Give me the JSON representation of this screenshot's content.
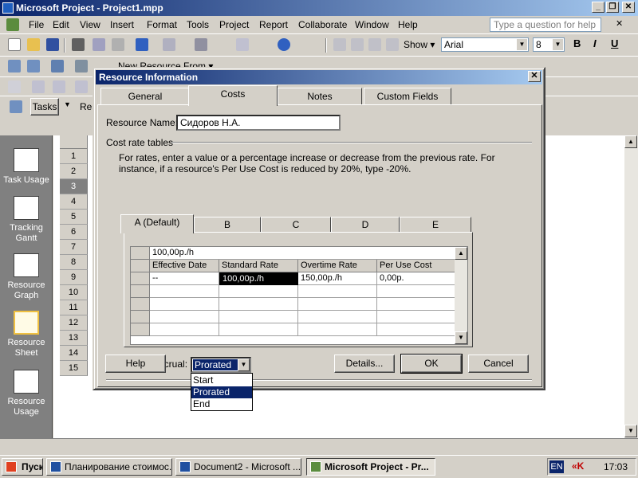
{
  "window": {
    "title": "Microsoft Project - Project1.mpp",
    "minimize": "_",
    "restore": "❐",
    "close": "✕"
  },
  "menu": {
    "items": [
      "File",
      "Edit",
      "View",
      "Insert",
      "Format",
      "Tools",
      "Project",
      "Report",
      "Collaborate",
      "Window",
      "Help"
    ],
    "help_placeholder": "Type a question for help",
    "doc_close": "✕"
  },
  "toolbar": {
    "show_label": "Show ▾",
    "font_name": "Arial",
    "font_size": "8",
    "bold": "B",
    "italic": "I",
    "underline": "U",
    "new_resource_from": "New Resource From ▾",
    "tasks": "Tasks",
    "resources": "Res"
  },
  "viewbar": {
    "items": [
      "Task Usage",
      "Tracking Gantt",
      "Resource Graph",
      "Resource Sheet",
      "Resource Usage"
    ],
    "selected": "Resource Sheet"
  },
  "rows": [
    "1",
    "2",
    "3",
    "4",
    "5",
    "6",
    "7",
    "8",
    "9",
    "10",
    "11",
    "12",
    "13",
    "14",
    "15"
  ],
  "dialog": {
    "title": "Resource Information",
    "close": "✕",
    "tabs": [
      "General",
      "Costs",
      "Notes",
      "Custom Fields"
    ],
    "active_tab": "Costs",
    "resource_name_label": "Resource Name:",
    "resource_name": "Сидоров Н.А.",
    "cost_rate_tables_label": "Cost rate tables",
    "instructions": "For rates, enter a value or a percentage increase or decrease from the previous rate. For instance, if a resource's Per Use Cost is reduced by 20%, type -20%.",
    "rate_tabs": [
      "A (Default)",
      "B",
      "C",
      "D",
      "E"
    ],
    "active_rate_tab": "A (Default)",
    "edit_value": "100,00р./h",
    "columns": [
      "Effective Date",
      "Standard Rate",
      "Overtime Rate",
      "Per Use Cost"
    ],
    "rate_rows": [
      {
        "effective_date": "--",
        "standard_rate": "100,00р./h",
        "overtime_rate": "150,00р./h",
        "per_use_cost": "0,00р."
      }
    ],
    "cost_accrual_label": "Cost accrual:",
    "cost_accrual_value": "Prorated",
    "cost_accrual_options": [
      "Start",
      "Prorated",
      "End"
    ],
    "buttons": {
      "help": "Help",
      "details": "Details...",
      "ok": "OK",
      "cancel": "Cancel"
    }
  },
  "taskbar": {
    "start": "Пуск",
    "tasks": [
      "Планирование стоимос...",
      "Document2 - Microsoft ...",
      "Microsoft Project - Pr..."
    ],
    "active_task": "Microsoft Project - Pr...",
    "lang": "EN",
    "clock": "17:03"
  }
}
